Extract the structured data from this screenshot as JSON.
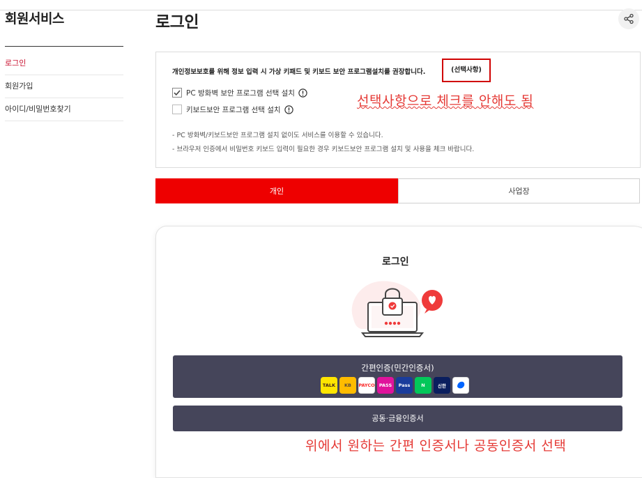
{
  "sidebar": {
    "title": "회원서비스",
    "items": [
      {
        "label": "로그인"
      },
      {
        "label": "회원가입"
      },
      {
        "label": "아이디/비밀번호찾기"
      }
    ]
  },
  "main": {
    "title": "로그인",
    "notice": "개인정보보호를 위해 정보 입력 시 가상 키패드 및 키보드 보안 프로그램설치를 권장합니다.",
    "optional_tag": "(선택사항)",
    "checkboxes": [
      {
        "label": "PC 방화벽 보안 프로그램 선택 설치",
        "checked": true
      },
      {
        "label": "키보드보안 프로그램 선택 설치",
        "checked": false
      }
    ],
    "notes": [
      "- PC 방화벽/키보드보안 프로그램 설치 없이도 서비스를 이용할 수 있습니다.",
      "- 브라우저 인증에서 비밀번호 키보드 입력이 필요한 경우 키보드보안 프로그램 설치 및 사용을 체크 바랍니다."
    ],
    "tabs": [
      {
        "label": "개인",
        "active": true
      },
      {
        "label": "사업장",
        "active": false
      }
    ],
    "card": {
      "title": "로그인",
      "simple_auth_label": "간편인증(민간인증서)",
      "joint_cert_label": "공동·금융인증서"
    },
    "auth_icons": [
      {
        "name": "kakao-talk-icon",
        "text": "TALK",
        "bg": "#fee500",
        "fg": "#3c1e1e"
      },
      {
        "name": "kb-icon",
        "text": "KB",
        "bg": "#ffbc00",
        "fg": "#5a4a3a"
      },
      {
        "name": "payco-icon",
        "text": "PAYCO",
        "bg": "#ffffff",
        "fg": "#fa2828"
      },
      {
        "name": "pass-icon",
        "text": "PASS",
        "bg": "#e0139c",
        "fg": "#ffffff"
      },
      {
        "name": "samsung-pass-icon",
        "text": "Pass",
        "bg": "#1a3c9c",
        "fg": "#ffffff"
      },
      {
        "name": "naver-icon",
        "text": "N",
        "bg": "#03c75a",
        "fg": "#ffffff"
      },
      {
        "name": "shinhan-icon",
        "text": "신한",
        "bg": "#0a1e5e",
        "fg": "#ffffff"
      },
      {
        "name": "toss-icon",
        "text": "",
        "bg": "#ffffff",
        "fg": "#0064ff"
      }
    ]
  },
  "annotations": {
    "optional_note": "선택사항으로 체크를 안해도 됨",
    "select_note": "위에서 원하는 간편 인증서나 공동인증서 선택"
  },
  "colors": {
    "accent": "#ee0000",
    "dark_button": "#45455a",
    "annotation": "#e53935",
    "sidebar_active": "#c8102e"
  }
}
